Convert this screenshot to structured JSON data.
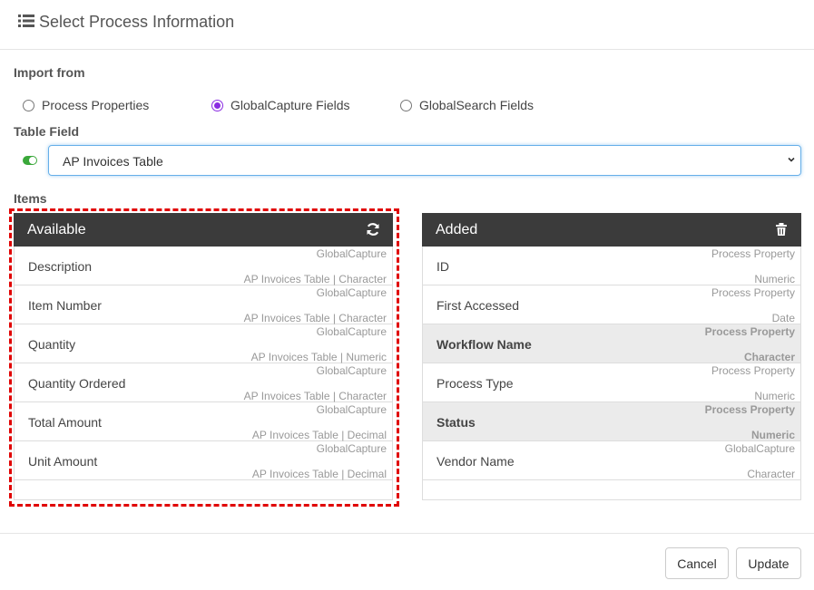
{
  "header": {
    "title": "Select Process Information",
    "icon": "list-icon"
  },
  "import": {
    "label": "Import from",
    "options": [
      {
        "label": "Process Properties",
        "selected": false
      },
      {
        "label": "GlobalCapture Fields",
        "selected": true
      },
      {
        "label": "GlobalSearch Fields",
        "selected": false
      }
    ]
  },
  "table_field": {
    "label": "Table Field",
    "value": "AP Invoices Table",
    "toggle_on": true
  },
  "items_label": "Items",
  "available": {
    "title": "Available",
    "action_icon": "refresh-icon",
    "rows": [
      {
        "name": "Description",
        "source": "GlobalCapture",
        "detail": "AP Invoices Table | Character"
      },
      {
        "name": "Item Number",
        "source": "GlobalCapture",
        "detail": "AP Invoices Table | Character"
      },
      {
        "name": "Quantity",
        "source": "GlobalCapture",
        "detail": "AP Invoices Table | Numeric"
      },
      {
        "name": "Quantity Ordered",
        "source": "GlobalCapture",
        "detail": "AP Invoices Table | Character"
      },
      {
        "name": "Total Amount",
        "source": "GlobalCapture",
        "detail": "AP Invoices Table | Decimal"
      },
      {
        "name": "Unit Amount",
        "source": "GlobalCapture",
        "detail": "AP Invoices Table | Decimal"
      }
    ]
  },
  "added": {
    "title": "Added",
    "action_icon": "trash-icon",
    "rows": [
      {
        "name": "ID",
        "source": "Process Property",
        "detail": "Numeric",
        "highlight": false
      },
      {
        "name": "First Accessed",
        "source": "Process Property",
        "detail": "Date",
        "highlight": false
      },
      {
        "name": "Workflow Name",
        "source": "Process Property",
        "detail": "Character",
        "highlight": true
      },
      {
        "name": "Process Type",
        "source": "Process Property",
        "detail": "Numeric",
        "highlight": false
      },
      {
        "name": "Status",
        "source": "Process Property",
        "detail": "Numeric",
        "highlight": true
      },
      {
        "name": "Vendor Name",
        "source": "GlobalCapture",
        "detail": "Character",
        "highlight": false
      }
    ]
  },
  "footer": {
    "cancel_label": "Cancel",
    "update_label": "Update"
  },
  "colors": {
    "accent": "#8a2be2",
    "panel_header": "#3b3b3b",
    "highlight_box": "#e00000",
    "toggle": "#3aa83a"
  }
}
